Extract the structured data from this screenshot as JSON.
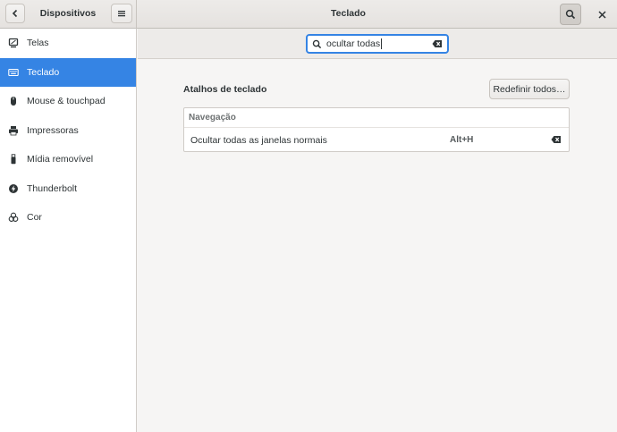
{
  "window": {
    "sidebar_title": "Dispositivos",
    "title": "Teclado"
  },
  "header_icons": {
    "back": "go-previous-icon",
    "menu": "hamburger-menu-icon",
    "search": "search-icon",
    "close": "close-icon"
  },
  "sidebar": {
    "items": [
      {
        "label": "Telas",
        "icon": "display-icon",
        "active": false
      },
      {
        "label": "Teclado",
        "icon": "keyboard-icon",
        "active": true
      },
      {
        "label": "Mouse & touchpad",
        "icon": "mouse-icon",
        "active": false
      },
      {
        "label": "Impressoras",
        "icon": "printer-icon",
        "active": false
      },
      {
        "label": "Mídia removível",
        "icon": "usb-drive-icon",
        "active": false
      },
      {
        "label": "Thunderbolt",
        "icon": "thunderbolt-icon",
        "active": false
      },
      {
        "label": "Cor",
        "icon": "color-icon",
        "active": false
      }
    ]
  },
  "search": {
    "value": "ocultar todas"
  },
  "content": {
    "section_title": "Atalhos de teclado",
    "reset_label": "Redefinir todos…",
    "group_header": "Navegação",
    "rows": [
      {
        "name": "Ocultar todas as janelas normais",
        "accel": "Alt+H"
      }
    ]
  },
  "colors": {
    "accent": "#3584e4",
    "sidebar_bg": "#ffffff",
    "window_bg": "#f6f5f4"
  }
}
